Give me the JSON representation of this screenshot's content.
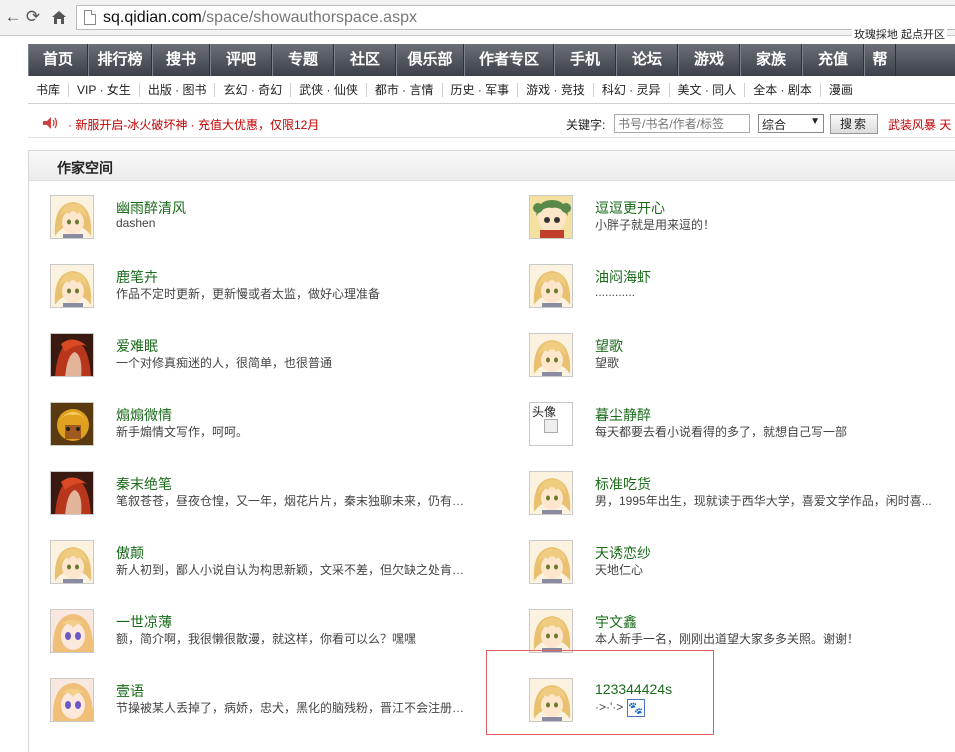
{
  "browser": {
    "url_host": "sq.qidian.com",
    "url_path": "/space/showauthorspace.aspx",
    "corner_text": "玫瑰採地  起点开区"
  },
  "mainnav": [
    "首页",
    "排行榜",
    "搜书",
    "评吧",
    "专题",
    "社区",
    "俱乐部",
    "作者专区",
    "手机",
    "论坛",
    "游戏",
    "家族",
    "充值",
    "帮"
  ],
  "subnav": [
    "书库",
    "VIP · 女生",
    "出版 · 图书",
    "玄幻 · 奇幻",
    "武侠 · 仙侠",
    "都市 · 言情",
    "历史 · 军事",
    "游戏 · 竞技",
    "科幻 · 灵异",
    "美文 · 同人",
    "全本 · 剧本",
    "漫画"
  ],
  "notice": {
    "text": "· 新服开启-冰火破坏神 ·  充值大优惠，仅限12月",
    "keyword_label": "关键字:",
    "search_placeholder": "书号/书名/作者/标签",
    "select_value": "综合",
    "search_button": "搜索",
    "right_link": "武装风暴  天"
  },
  "panel": {
    "title": "作家空间"
  },
  "authors_left": [
    {
      "name": "幽雨醉清风",
      "desc": "dashen",
      "avatar": "blond"
    },
    {
      "name": "鹿笔卉",
      "desc": "作品不定时更新，更新慢或者太监，做好心理准备",
      "avatar": "blond"
    },
    {
      "name": "爱难眠",
      "desc": "一个对修真痴迷的人，很简单，也很普通",
      "avatar": "red"
    },
    {
      "name": "煽煽微情",
      "desc": "新手煽情文写作，呵呵。",
      "avatar": "warrior"
    },
    {
      "name": "秦末绝笔",
      "desc": "笔叙苍苍，昼夜仓惶，又一年，烟花片片，秦末独聊未来，仍有不...",
      "avatar": "red"
    },
    {
      "name": "傲颠",
      "desc": "新人初到，鄙人小说自认为构思新颖，文采不差，但欠缺之处肯定...",
      "avatar": "blond"
    },
    {
      "name": "一世凉薄",
      "desc": "额，简介啊，我很懒很散漫，就这样，你看可以么？嘿嘿",
      "avatar": "girl"
    },
    {
      "name": "壹语",
      "desc": "节操被某人丢掉了，病娇，忠犬，黑化的脑残粉，晋江不会注册的...",
      "avatar": "girl"
    }
  ],
  "authors_right": [
    {
      "name": "逗逗更开心",
      "desc": "小胖子就是用来逗的！",
      "avatar": "chibi"
    },
    {
      "name": "油闷海虾",
      "desc": "............",
      "avatar": "blond"
    },
    {
      "name": "望歌",
      "desc": "望歌",
      "avatar": "blond"
    },
    {
      "name": "暮尘静醉",
      "desc": "每天都要去看小说看得的多了，就想自己写一部",
      "avatar": "broken",
      "alt": "头像"
    },
    {
      "name": "标准吃货",
      "desc": "男，1995年出生，现就读于西华大学，喜爱文学作品，闲时喜...",
      "avatar": "blond"
    },
    {
      "name": "天诱恋纱",
      "desc": "天地仁心",
      "avatar": "blond"
    },
    {
      "name": "宇文鑫",
      "desc": "本人新手一名，刚刚出道望大家多多关照。谢谢！",
      "avatar": "blond"
    },
    {
      "name": "123344424s",
      "desc": "·>·'·>",
      "avatar": "blond",
      "badge": "🐾"
    }
  ]
}
